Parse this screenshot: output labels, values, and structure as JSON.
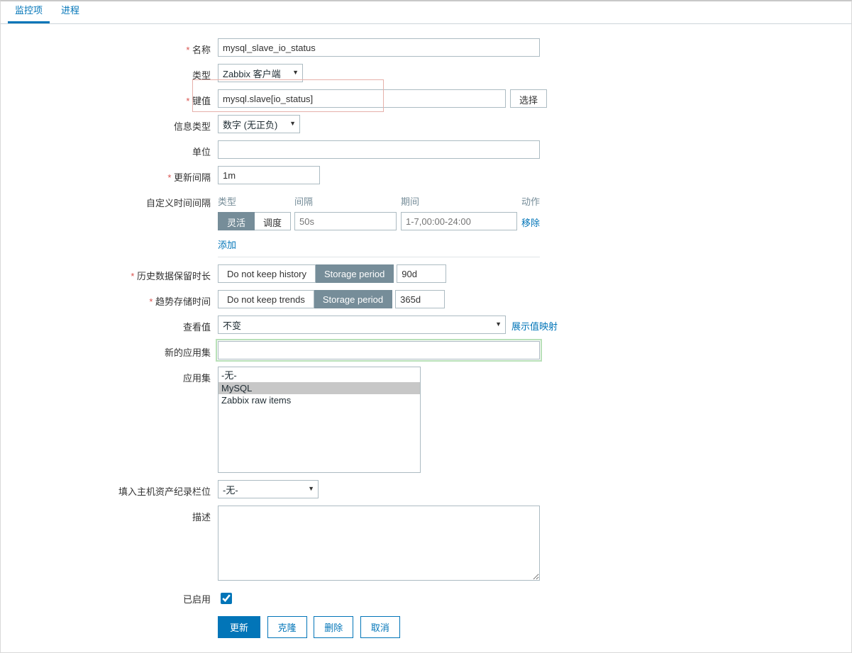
{
  "tabs": {
    "item0": "监控项",
    "item1": "进程"
  },
  "form": {
    "name_label": "名称",
    "name_value": "mysql_slave_io_status",
    "type_label": "类型",
    "type_value": "Zabbix 客户端",
    "key_label": "键值",
    "key_value": "mysql.slave[io_status]",
    "key_select_btn": "选择",
    "infotype_label": "信息类型",
    "infotype_value": "数字 (无正负)",
    "units_label": "单位",
    "units_value": "",
    "update_interval_label": "更新间隔",
    "update_interval_value": "1m",
    "custom_intervals_label": "自定义时间间隔",
    "ci_th_type": "类型",
    "ci_th_interval": "间隔",
    "ci_th_period": "期间",
    "ci_th_action": "动作",
    "ci_seg_flex": "灵活",
    "ci_seg_sched": "调度",
    "ci_interval_ph": "50s",
    "ci_period_ph": "1-7,00:00-24:00",
    "ci_remove": "移除",
    "ci_add": "添加",
    "history_label": "历史数据保留时长",
    "history_seg0": "Do not keep history",
    "history_seg1": "Storage period",
    "history_value": "90d",
    "trend_label": "趋势存储时间",
    "trend_seg0": "Do not keep trends",
    "trend_seg1": "Storage period",
    "trend_value": "365d",
    "showvalue_label": "查看值",
    "showvalue_value": "不变",
    "showvalue_link": "展示值映射",
    "newapp_label": "新的应用集",
    "newapp_value": "",
    "apps_label": "应用集",
    "apps_opt0": "-无-",
    "apps_opt1": "MySQL",
    "apps_opt2": "Zabbix raw items",
    "inventory_label": "填入主机资产纪录栏位",
    "inventory_value": "-无-",
    "desc_label": "描述",
    "desc_value": "",
    "enabled_label": "已启用",
    "btn_update": "更新",
    "btn_clone": "克隆",
    "btn_delete": "删除",
    "btn_cancel": "取消"
  }
}
